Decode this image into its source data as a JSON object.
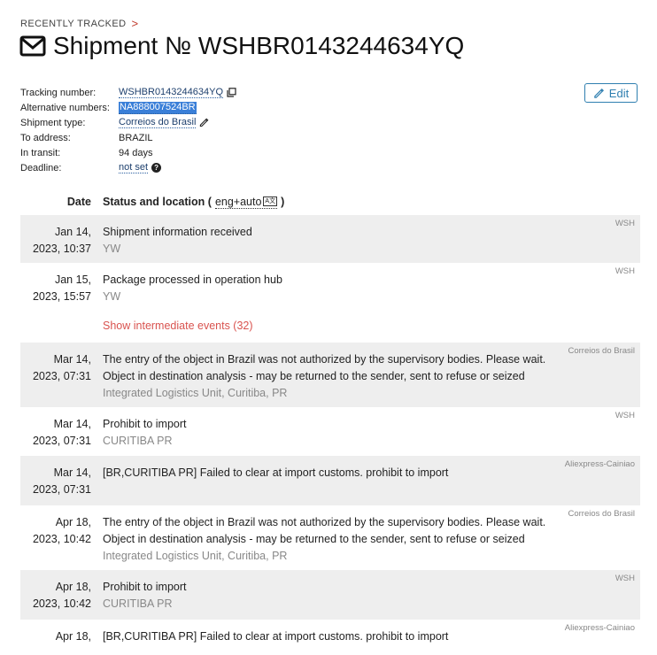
{
  "breadcrumb": {
    "label": "RECENTLY TRACKED",
    "chevron": ">"
  },
  "title": {
    "text": "Shipment № WSHBR0143244634YQ",
    "icon": "envelope-icon"
  },
  "edit_button": {
    "label": "Edit",
    "icon": "pencil-icon"
  },
  "info": {
    "tracking_label": "Tracking number:",
    "tracking_value": "WSHBR0143244634YQ",
    "alt_label": "Alternative numbers:",
    "alt_value": "NA888007524BR",
    "type_label": "Shipment type:",
    "type_value": "Correios do Brasil",
    "address_label": "To address:",
    "address_value": "BRAZIL",
    "transit_label": "In transit:",
    "transit_value": "94 days",
    "deadline_label": "Deadline:",
    "deadline_value": "not set",
    "help_glyph": "?"
  },
  "table_header": {
    "date": "Date",
    "status": "Status and location (",
    "lang": "eng+auto",
    "lang_icon": "A文",
    "close": ")"
  },
  "show_more": "Show intermediate events (32)",
  "events": [
    {
      "date1": "Jan 14,",
      "date2": "2023, 10:37",
      "status": "Shipment information received",
      "status2": "",
      "loc": "YW",
      "source": "WSH"
    },
    {
      "date1": "Jan 15,",
      "date2": "2023, 15:57",
      "status": "Package processed in operation hub",
      "status2": "",
      "loc": "YW",
      "source": "WSH"
    },
    {
      "date1": "Mar 14,",
      "date2": "2023, 07:31",
      "status": "The entry of the object in Brazil was not authorized by the supervisory bodies. Please wait.",
      "status2": "Object in destination analysis - may be returned to the sender, sent to refuse or seized",
      "loc": "Integrated Logistics Unit, Curitiba, PR",
      "source": "Correios do Brasil"
    },
    {
      "date1": "Mar 14,",
      "date2": "2023, 07:31",
      "status": "Prohibit to import",
      "status2": "",
      "loc": "CURITIBA PR",
      "source": "WSH"
    },
    {
      "date1": "Mar 14,",
      "date2": "2023, 07:31",
      "status": "[BR,CURITIBA PR] Failed to clear at import customs. prohibit to import",
      "status2": "",
      "loc": "",
      "source": "Aliexpress-Cainiao"
    },
    {
      "date1": "Apr 18,",
      "date2": "2023, 10:42",
      "status": "The entry of the object in Brazil was not authorized by the supervisory bodies. Please wait.",
      "status2": "Object in destination analysis - may be returned to the sender, sent to refuse or seized",
      "loc": "Integrated Logistics Unit, Curitiba, PR",
      "source": "Correios do Brasil"
    },
    {
      "date1": "Apr 18,",
      "date2": "2023, 10:42",
      "status": "Prohibit to import",
      "status2": "",
      "loc": "CURITIBA PR",
      "source": "WSH"
    },
    {
      "date1": "Apr 18,",
      "date2": "",
      "status": "[BR,CURITIBA PR] Failed to clear at import customs. prohibit to import",
      "status2": "",
      "loc": "",
      "source": "Aliexpress-Cainiao"
    }
  ]
}
